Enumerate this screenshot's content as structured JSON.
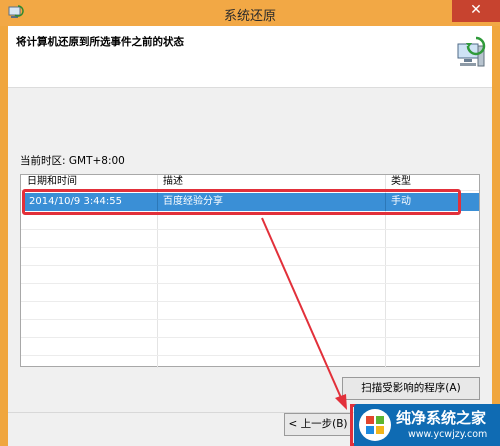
{
  "window": {
    "title": "系统还原",
    "close_glyph": "✕",
    "icon": "system-restore-icon"
  },
  "header": {
    "title": "将计算机还原到所选事件之前的状态",
    "art_icon": "system-restore-computer-icon"
  },
  "timezone": {
    "label": "当前时区: GMT+8:00"
  },
  "list": {
    "columns": [
      "日期和时间",
      "描述",
      "类型"
    ],
    "rows": [
      {
        "date": "2014/10/9 3:44:55",
        "description": "百度经验分享",
        "type": "手动",
        "selected": true
      }
    ]
  },
  "buttons": {
    "scan": "扫描受影响的程序(A)",
    "back": "< 上一步(B)"
  },
  "watermark": {
    "title": "纯净系统之家",
    "url": "www.ycwjzy.com"
  },
  "colors": {
    "title_bar": "#f2a845",
    "selection": "#3a8fd6",
    "highlight_red": "#e2303a",
    "close_button": "#c7432f",
    "watermark_blue": "#0f6bb3"
  }
}
